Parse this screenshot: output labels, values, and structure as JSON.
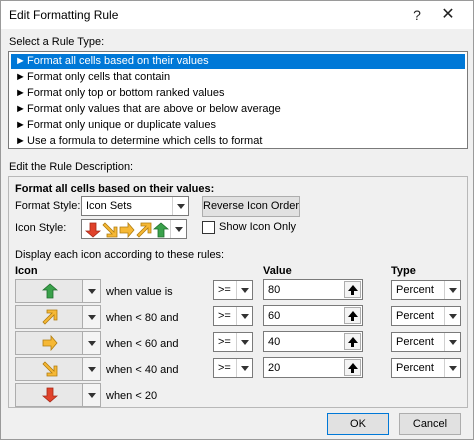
{
  "window": {
    "title": "Edit Formatting Rule",
    "help_glyph": "?",
    "close_glyph": "✕"
  },
  "rule_type": {
    "label": "Select a Rule Type:",
    "items": [
      {
        "label": "Format all cells based on their values",
        "selected": true
      },
      {
        "label": "Format only cells that contain",
        "selected": false
      },
      {
        "label": "Format only top or bottom ranked values",
        "selected": false
      },
      {
        "label": "Format only values that are above or below average",
        "selected": false
      },
      {
        "label": "Format only unique or duplicate values",
        "selected": false
      },
      {
        "label": "Use a formula to determine which cells to format",
        "selected": false
      }
    ]
  },
  "description": {
    "label": "Edit the Rule Description:",
    "heading": "Format all cells based on their values:",
    "format_style_label": "Format Style:",
    "format_style_value": "Icon Sets",
    "reverse_button": "Reverse Icon Order",
    "icon_style_label": "Icon Style:",
    "show_icon_only": "Show Icon Only",
    "show_icon_only_checked": false,
    "display_rules_label": "Display each icon according to these rules:",
    "col_icon": "Icon",
    "col_value": "Value",
    "col_type": "Type",
    "rows": [
      {
        "icon": "green-up-arrow-icon",
        "condition": "when value is",
        "operator": ">=",
        "value": "80",
        "type": "Percent"
      },
      {
        "icon": "yellow-up-right-arrow-icon",
        "condition": "when < 80 and",
        "operator": ">=",
        "value": "60",
        "type": "Percent"
      },
      {
        "icon": "yellow-right-arrow-icon",
        "condition": "when < 60 and",
        "operator": ">=",
        "value": "40",
        "type": "Percent"
      },
      {
        "icon": "yellow-down-right-arrow-icon",
        "condition": "when < 40 and",
        "operator": ">=",
        "value": "20",
        "type": "Percent"
      },
      {
        "icon": "red-down-arrow-icon",
        "condition": "when < 20"
      }
    ]
  },
  "footer": {
    "ok": "OK",
    "cancel": "Cancel"
  },
  "colors": {
    "selection": "#0078d7",
    "green": "#3aa14b",
    "yellow": "#f6b835",
    "red": "#e0422b"
  }
}
